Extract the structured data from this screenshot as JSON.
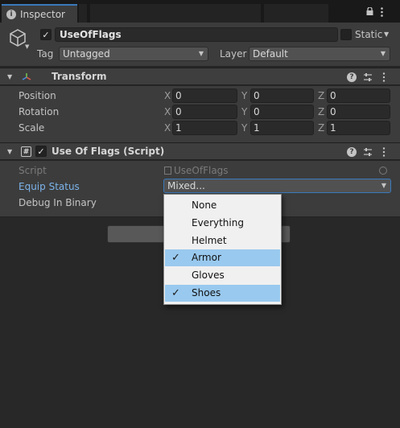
{
  "tab": {
    "title": "Inspector"
  },
  "header": {
    "object_name": "UseOfFlags",
    "active": true,
    "static_label": "Static",
    "tag_label": "Tag",
    "tag_value": "Untagged",
    "layer_label": "Layer",
    "layer_value": "Default"
  },
  "transform": {
    "title": "Transform",
    "rows": [
      {
        "label": "Position",
        "x": "0",
        "y": "0",
        "z": "0"
      },
      {
        "label": "Rotation",
        "x": "0",
        "y": "0",
        "z": "0"
      },
      {
        "label": "Scale",
        "x": "1",
        "y": "1",
        "z": "1"
      }
    ],
    "axis_x": "X",
    "axis_y": "Y",
    "axis_z": "Z"
  },
  "script_component": {
    "title": "Use Of Flags (Script)",
    "enabled": true,
    "script_label": "Script",
    "script_value": "UseOfFlags",
    "equip_label": "Equip Status",
    "equip_value": "Mixed...",
    "debug_label": "Debug In Binary"
  },
  "popup_menu": {
    "items": [
      {
        "label": "None",
        "checked": false,
        "highlighted": false
      },
      {
        "label": "Everything",
        "checked": false,
        "highlighted": false
      },
      {
        "label": "Helmet",
        "checked": false,
        "highlighted": false
      },
      {
        "label": "Armor",
        "checked": true,
        "highlighted": true
      },
      {
        "label": "Gloves",
        "checked": false,
        "highlighted": false
      },
      {
        "label": "Shoes",
        "checked": true,
        "highlighted": true
      }
    ]
  },
  "icons": {
    "tab": "info-icon",
    "lock": "lock-icon",
    "menu": "kebab-menu-icon",
    "object": "cube-icon",
    "transform": "transform-axes-icon",
    "script": "script-hash-icon",
    "help": "help-icon",
    "presets": "presets-sliders-icon",
    "more": "kebab-menu-icon",
    "target": "object-picker-icon"
  },
  "colors": {
    "accent": "#3a79bb",
    "selection": "#99c9ef",
    "link_label": "#7cb3ea"
  }
}
